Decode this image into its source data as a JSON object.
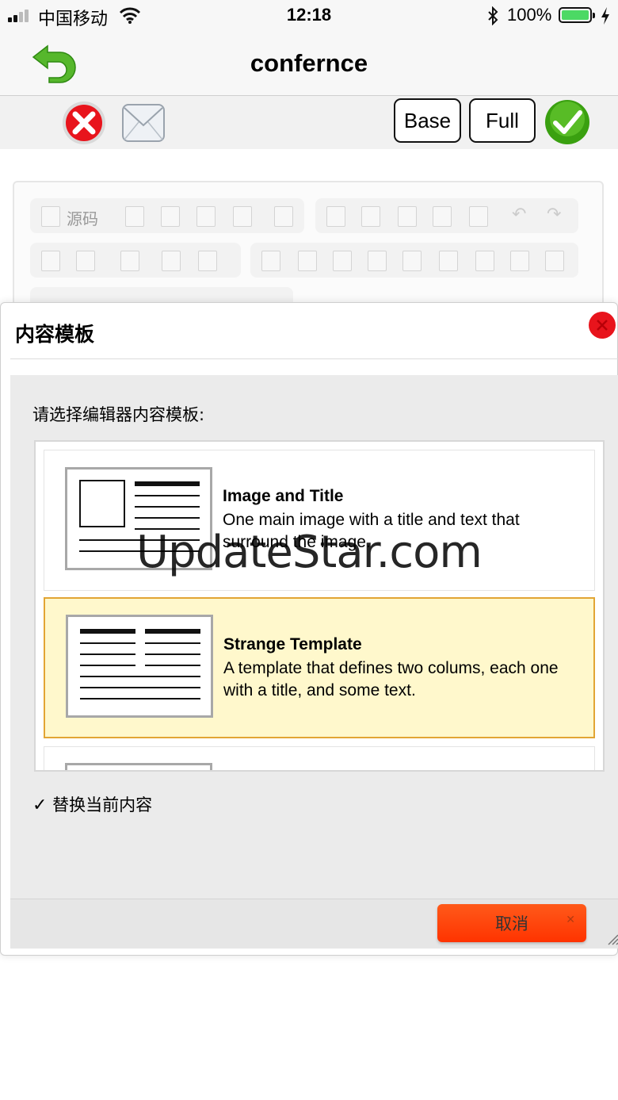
{
  "status_bar": {
    "carrier": "中国移动",
    "time": "12:18",
    "battery": "100%",
    "icons": [
      "signal-icon",
      "wifi-icon",
      "bluetooth-icon",
      "battery-icon",
      "charging-icon"
    ]
  },
  "nav": {
    "title": "confernce",
    "back_icon": "back-arrow-icon"
  },
  "toolbar": {
    "base_label": "Base",
    "full_label": "Full",
    "icons": [
      "delete-icon",
      "mail-icon",
      "confirm-check-icon"
    ]
  },
  "editor": {
    "source_label": "源码"
  },
  "dialog": {
    "title": "内容模板",
    "prompt": "请选择编辑器内容模板:",
    "templates": [
      {
        "name": "Image and Title",
        "description": "One main image with a title and text that surround the image.",
        "selected": false
      },
      {
        "name": "Strange Template",
        "description": "A template that defines two colums, each one with a title, and some text.",
        "selected": true
      }
    ],
    "replace_label": "替换当前内容",
    "replace_checked": true,
    "cancel_label": "取消"
  },
  "watermark": "UpdateStar.com",
  "colors": {
    "selected_bg": "#fff8cc",
    "selected_border": "#e2a534",
    "cancel_bg": "#ff4a10",
    "close_red": "#e8141c",
    "confirm_green": "#3aa010",
    "battery_green": "#4cd964"
  }
}
